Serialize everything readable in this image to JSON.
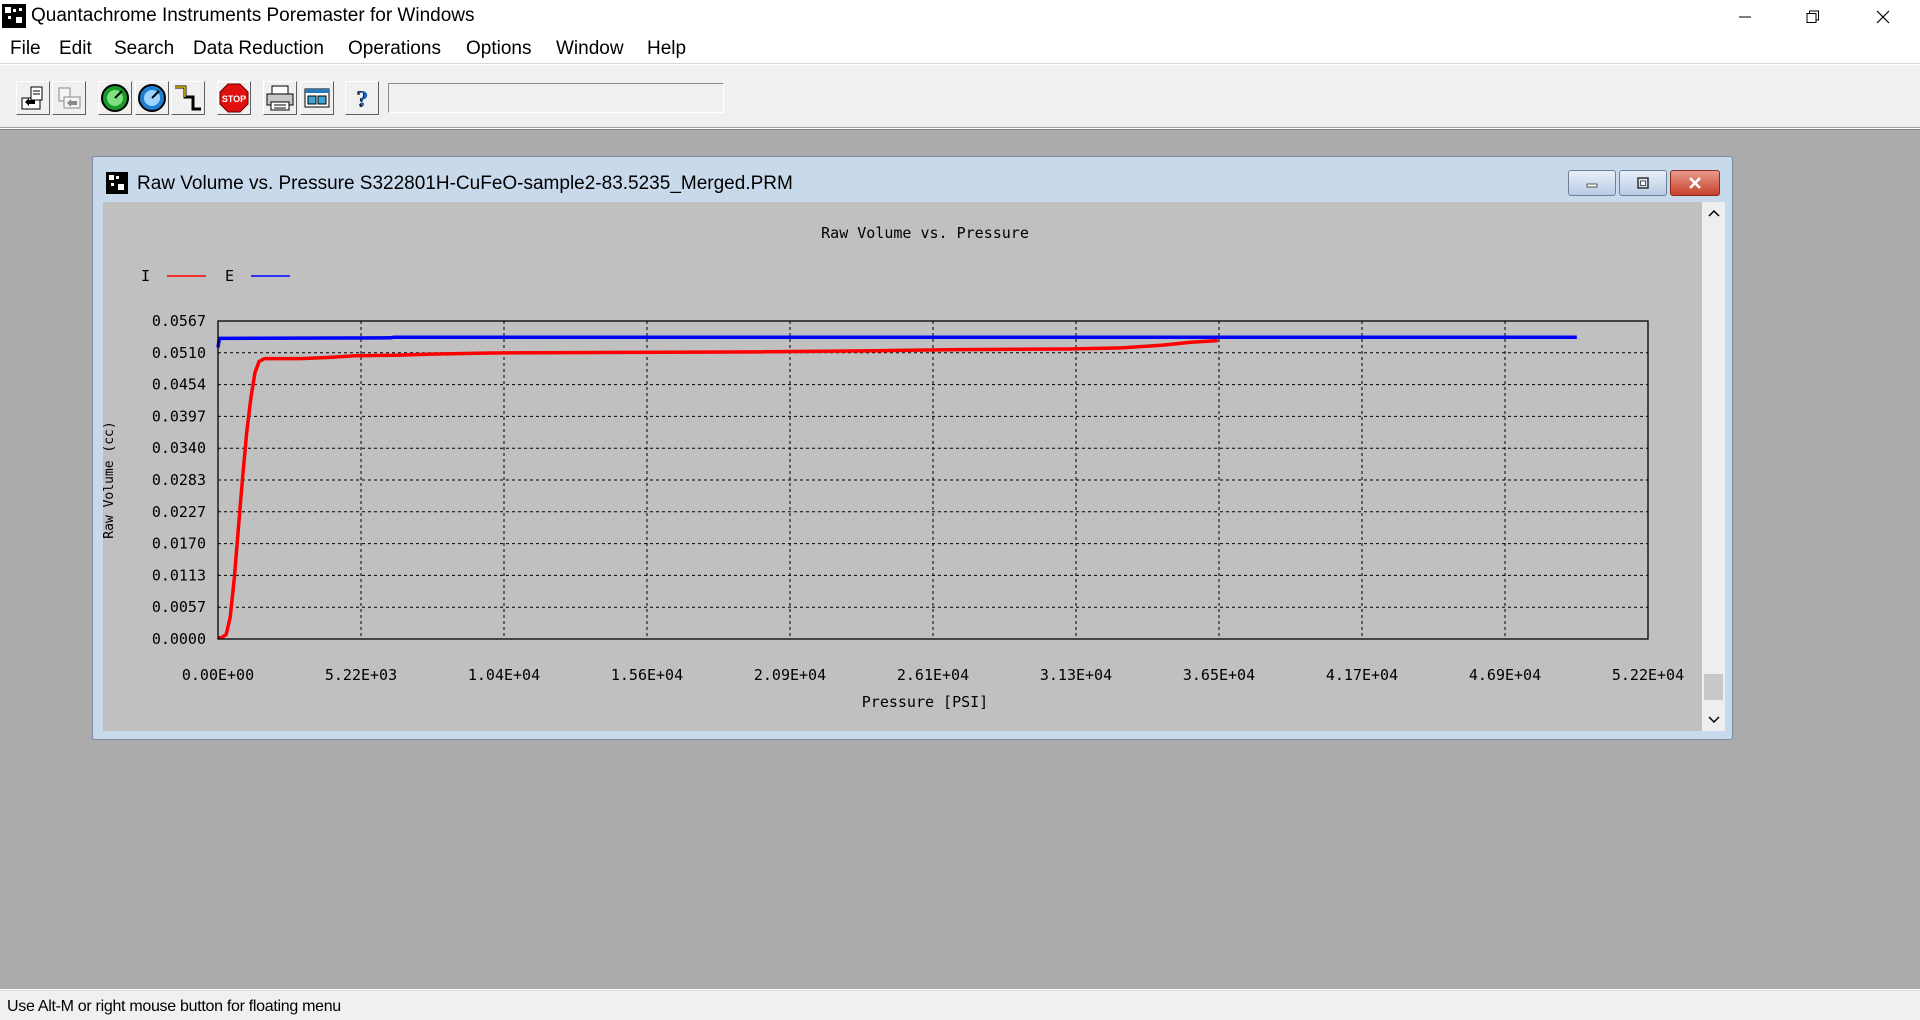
{
  "app": {
    "title": "Quantachrome Instruments Poremaster for Windows",
    "icon": "app-logo-icon"
  },
  "window_controls": [
    "minimize-icon",
    "restore-icon",
    "close-icon"
  ],
  "menu": [
    "File",
    "Edit",
    "Search",
    "Data Reduction",
    "Operations",
    "Options",
    "Window",
    "Help"
  ],
  "toolbar": {
    "buttons": [
      {
        "name": "open-file-button",
        "icon": "open-file-icon"
      },
      {
        "name": "save-file-button",
        "icon": "save-file-icon"
      },
      {
        "name": "start-analysis-button",
        "icon": "green-gauge-icon"
      },
      {
        "name": "pressure-gauge-button",
        "icon": "blue-gauge-icon"
      },
      {
        "name": "step-graph-button",
        "icon": "step-graph-icon"
      },
      {
        "name": "stop-button",
        "icon": "stop-sign-icon"
      },
      {
        "name": "print-button",
        "icon": "printer-icon"
      },
      {
        "name": "report-button",
        "icon": "report-icon"
      },
      {
        "name": "help-button",
        "icon": "help-icon"
      }
    ],
    "field_value": ""
  },
  "child_window": {
    "title": "Raw Volume vs. Pressure S322801H-CuFeO-sample2-83.5235_Merged.PRM",
    "icon": "chart-document-icon"
  },
  "status": {
    "text": "Use Alt-M or right mouse button for floating menu"
  },
  "chart_data": {
    "type": "line",
    "title": "Raw Volume vs. Pressure",
    "xlabel": "Pressure [PSI]",
    "ylabel": "Raw Volume (cc)",
    "xlim": [
      0,
      52200
    ],
    "ylim": [
      0,
      0.0567
    ],
    "x_ticks": [
      "0.00E+00",
      "5.22E+03",
      "1.04E+04",
      "1.56E+04",
      "2.09E+04",
      "2.61E+04",
      "3.13E+04",
      "3.65E+04",
      "4.17E+04",
      "4.69E+04",
      "5.22E+04"
    ],
    "y_ticks": [
      "0.0000",
      "0.0057",
      "0.0113",
      "0.0170",
      "0.0227",
      "0.0283",
      "0.0340",
      "0.0397",
      "0.0454",
      "0.0510",
      "0.0567"
    ],
    "grid": true,
    "legend_position": "top-left",
    "series": [
      {
        "name": "I",
        "color": "#ff0000",
        "points": [
          [
            0,
            0.0002
          ],
          [
            150,
            0.0003
          ],
          [
            300,
            0.0008
          ],
          [
            450,
            0.004
          ],
          [
            600,
            0.011
          ],
          [
            750,
            0.02
          ],
          [
            900,
            0.029
          ],
          [
            1050,
            0.037
          ],
          [
            1200,
            0.043
          ],
          [
            1350,
            0.0475
          ],
          [
            1500,
            0.0495
          ],
          [
            1700,
            0.05
          ],
          [
            2000,
            0.05
          ],
          [
            3000,
            0.05
          ],
          [
            4000,
            0.0502
          ],
          [
            5000,
            0.0505
          ],
          [
            6500,
            0.0506
          ],
          [
            7800,
            0.0508
          ],
          [
            10000,
            0.051
          ],
          [
            15000,
            0.0511
          ],
          [
            20000,
            0.0512
          ],
          [
            24000,
            0.0514
          ],
          [
            27000,
            0.0516
          ],
          [
            31000,
            0.0517
          ],
          [
            33000,
            0.0519
          ],
          [
            34500,
            0.0524
          ],
          [
            35500,
            0.0529
          ],
          [
            36500,
            0.0532
          ]
        ]
      },
      {
        "name": "E",
        "color": "#0000ff",
        "points": [
          [
            0,
            0.052
          ],
          [
            50,
            0.0536
          ],
          [
            6300,
            0.0537
          ],
          [
            6400,
            0.0538
          ],
          [
            10000,
            0.0538
          ],
          [
            20000,
            0.0538
          ],
          [
            30000,
            0.0538
          ],
          [
            40000,
            0.0538
          ],
          [
            49600,
            0.0538
          ]
        ]
      }
    ]
  }
}
